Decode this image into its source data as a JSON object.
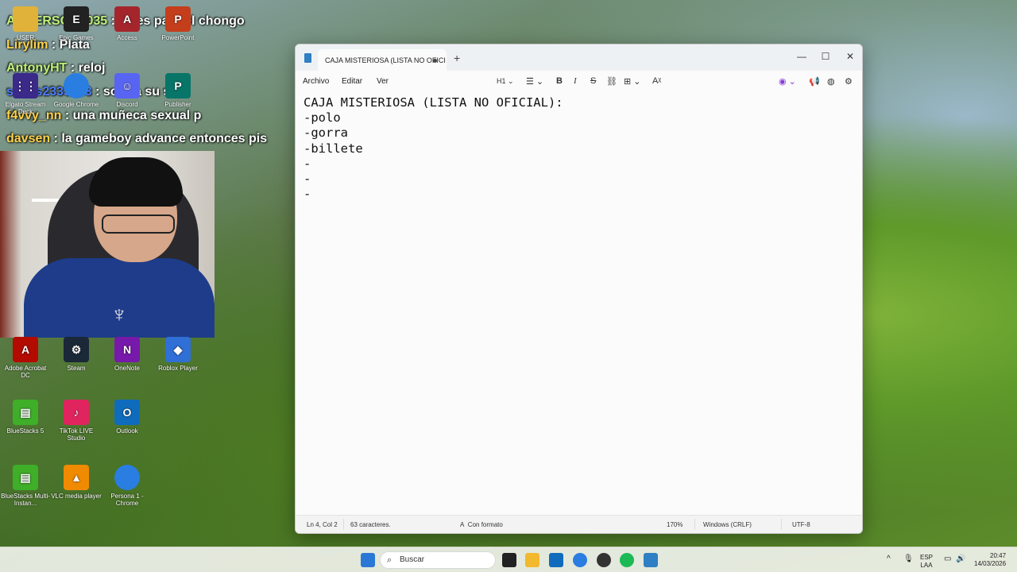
{
  "chat": [
    {
      "user": "ANDERSON2035",
      "msg": "vales para el chongo",
      "user_color": "#bff27a"
    },
    {
      "user": "Lirylim",
      "msg": "Plata",
      "user_color": "#ffd24a"
    },
    {
      "user": "AntonyHT",
      "msg": "reloj",
      "user_color": "#bff27a"
    },
    {
      "user": "sebas2333333",
      "msg": "sortea su silla",
      "user_color": "#4a7cff"
    },
    {
      "user": "f4vvy_nn",
      "msg": "una muñeca sexual p",
      "user_color": "#ffd24a"
    },
    {
      "user": "davsen",
      "msg": "la gameboy advance entonces pis",
      "user_color": "#ffd24a"
    }
  ],
  "desktop_icons": [
    {
      "label": "USER",
      "icon": "folder-icon",
      "color": "#e0b23a"
    },
    {
      "label": "Epic Games",
      "icon": "epic-games-icon",
      "color": "#222222"
    },
    {
      "label": "Access",
      "icon": "access-icon",
      "color": "#a4262c"
    },
    {
      "label": "PowerPoint",
      "icon": "powerpoint-icon",
      "color": "#c43e1c"
    },
    {
      "label": "Elgato Stream Deck",
      "icon": "stream-deck-icon",
      "color": "#3b2a8a"
    },
    {
      "label": "Google Chrome",
      "icon": "chrome-icon",
      "color": "#2a7de1"
    },
    {
      "label": "Discord",
      "icon": "discord-icon",
      "color": "#5865f2"
    },
    {
      "label": "Publisher",
      "icon": "publisher-icon",
      "color": "#077568"
    },
    {
      "label": "Adobe Acrobat DC",
      "icon": "acrobat-icon",
      "color": "#b30b00"
    },
    {
      "label": "Steam",
      "icon": "steam-icon",
      "color": "#1b2838"
    },
    {
      "label": "OneNote",
      "icon": "onenote-icon",
      "color": "#7719aa"
    },
    {
      "label": "Roblox Player",
      "icon": "roblox-icon",
      "color": "#2f6fd6"
    },
    {
      "label": "BlueStacks 5",
      "icon": "bluestacks-icon",
      "color": "#3fae29"
    },
    {
      "label": "TikTok LIVE Studio",
      "icon": "tiktok-icon",
      "color": "#e0245e"
    },
    {
      "label": "Outlook",
      "icon": "outlook-icon",
      "color": "#0f6cbd"
    },
    {
      "label": "BlueStacks Multi-Instan...",
      "icon": "bluestacks-multi-icon",
      "color": "#3fae29"
    },
    {
      "label": "VLC media player",
      "icon": "vlc-icon",
      "color": "#f08a00"
    },
    {
      "label": "Persona 1 - Chrome",
      "icon": "chrome-persona-icon",
      "color": "#2a7de1"
    }
  ],
  "notepad": {
    "tab_title": "CAJA MISTERIOSA (LISTA NO OFICI",
    "new_tab": "+",
    "menu": [
      "Archivo",
      "Editar",
      "Ver"
    ],
    "heading_select": "H1",
    "lines": [
      "CAJA MISTERIOSA (LISTA NO OFICIAL):",
      "-polo",
      "-gorra",
      "-billete",
      "-",
      "-",
      "-"
    ],
    "status": {
      "position": "Ln 4, Col 2",
      "chars": "63 caracteres.",
      "format": "Con formato",
      "zoom": "170%",
      "line_ending": "Windows (CRLF)",
      "encoding": "UTF-8"
    }
  },
  "taskbar": {
    "search_placeholder": "Buscar",
    "lang": "ESP",
    "lang_sub": "LAA",
    "time": "20:47",
    "date": "14/03/2026"
  }
}
